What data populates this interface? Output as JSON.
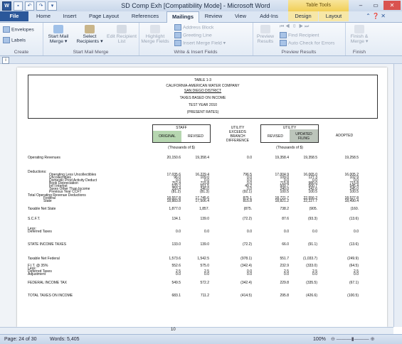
{
  "window": {
    "title": "SD Comp Exh [Compatibility Mode] - Microsoft Word",
    "contextual_label": "Table Tools",
    "qat_icons": [
      "word-icon",
      "save-icon",
      "undo-icon",
      "redo-icon",
      "customize-icon"
    ],
    "controls": {
      "minimize": "–",
      "restore": "▭",
      "close": "✕"
    }
  },
  "tabs": [
    "File",
    "Home",
    "Insert",
    "Page Layout",
    "References",
    "Mailings",
    "Review",
    "View",
    "Add-Ins",
    "Design",
    "Layout"
  ],
  "active_tab": "Mailings",
  "ribbon": {
    "create": {
      "label": "Create",
      "envelopes": "Envelopes",
      "labels": "Labels"
    },
    "start": {
      "label": "Start Mail Merge",
      "start_merge": "Start Mail Merge ▾",
      "select_recipients": "Select Recipients ▾",
      "edit_list": "Edit Recipient List"
    },
    "write": {
      "label": "Write & Insert Fields",
      "highlight": "Highlight Merge Fields",
      "address_block": "Address Block",
      "greeting_line": "Greeting Line",
      "insert_field": "Insert Merge Field ▾"
    },
    "preview": {
      "label": "Preview Results",
      "preview_results": "Preview Results",
      "find_recipient": "Find Recipient",
      "auto_check": "Auto Check for Errors"
    },
    "finish": {
      "label": "Finish",
      "finish_merge": "Finish & Merge ▾"
    }
  },
  "document": {
    "table_no": "TABLE 1-3",
    "company": "CALIFORNIA-AMERICAN WATER COMPANY",
    "district": "SAN DIEGO DISTRICT",
    "subtitle": "TAXES BASED ON INCOME",
    "year": "TEST YEAR 2010",
    "rates": "(PRESENT RATES)",
    "staff_hdr": "STAFF",
    "original": "ORIGINAL",
    "revised": "REVISED",
    "utility_exceeds": "UTILITY EXCEEDS BRANCH DIFFERENCE",
    "utility_hdr": "UTILITY",
    "utility_revised": "REVISED",
    "updated_filing": "UPDATED FILING",
    "adopted": "ADOPTED",
    "thousands_staff": "(Thousands of $)",
    "thousands_util": "(Thousands of $)",
    "rows": [
      {
        "label": "Operating Revenues",
        "v": [
          "20,150.6",
          "19,358.4",
          "0.0",
          "19,358.4",
          "19,358.5",
          "19,258.5"
        ]
      },
      {
        "label": "Deductions:",
        "v": [
          "",
          "",
          "",
          "",
          "",
          ""
        ]
      },
      {
        "label": "Operating Less Uncollectibles",
        "v": [
          "17,035.6",
          "16,229.4",
          "796.5",
          "17,004.9",
          "16,065.0",
          "16,005.2"
        ]
      },
      {
        "label": "Uncollectibles",
        "v": [
          "96.0",
          "109.0",
          "0.0",
          "109.0",
          "127.3",
          "102.9"
        ]
      },
      {
        "label": "Domestic Prod Activity Deduct",
        "v": [
          "0.0",
          "0.0",
          "0.0",
          "0.0",
          "0.0",
          "0.0"
        ]
      },
      {
        "label": "Book Depreciation",
        "v": [
          "752.4",
          "715.8",
          "0.0",
          "715.8",
          "980.0",
          "715.8"
        ]
      },
      {
        "label": "Int'l Interest",
        "v": [
          "520.3",
          "551.5",
          "49.2",
          "500.7",
          "500.7",
          "545.4"
        ]
      },
      {
        "label": "Taxes Other Than Income",
        "v": [
          "250.4",
          "240.0",
          "0.0",
          "240.0",
          "242.6",
          "245.0"
        ]
      },
      {
        "label": "Previous Year CCFT",
        "v": [
          "(81.2)",
          "(81.3)",
          "(92.1)",
          "100.5",
          "100.5",
          "100.5"
        ]
      },
      {
        "label": "Total Operating Revenue Deductions",
        "v": [
          "",
          "",
          "",
          "",
          "",
          ""
        ]
      },
      {
        "label": "Federal",
        "v": [
          "18,557.8",
          "17,745.6",
          "875.1",
          "18,721.7",
          "22,556.2",
          "18,527.8"
        ]
      },
      {
        "label": "State",
        "v": [
          "18,883.8",
          "17,506.4",
          "815.8",
          "18,821.2",
          "22,227.7",
          "18,490.4"
        ]
      },
      {
        "label": "Taxable Net State",
        "v": [
          "1,877.0",
          "1,857.",
          "(875.",
          "738.2",
          "(905.",
          "(160."
        ]
      },
      {
        "label": "S.C.F.T.",
        "v": [
          "134.1",
          "139.0",
          "(72.2)",
          "87.6",
          "(93.3)",
          "(13.6)"
        ]
      },
      {
        "label": "Less:",
        "v": [
          "",
          "",
          "",
          "",
          "",
          ""
        ]
      },
      {
        "label": "Deferred Taxes",
        "v": [
          "0.0",
          "0.0",
          "0.0",
          "0.0",
          "0.0",
          "0.0"
        ]
      },
      {
        "label": "STATE INCOME TAXES",
        "v": [
          "133.0",
          "139.0",
          "(72.2)",
          "66.0",
          "(91.1)",
          "(13.6)"
        ]
      },
      {
        "label": "Taxable Net Federal",
        "v": [
          "1,573.6",
          "1,542.5",
          "(978.1)",
          "551.7",
          "(1,033.7)",
          "(249.9)"
        ]
      },
      {
        "label": "F.I.T. @ 35%",
        "v": [
          "552.6",
          "575.0",
          "(342.4)",
          "232.9",
          "(333.0)",
          "(64.5)"
        ]
      },
      {
        "label": "Less:",
        "v": [
          "",
          "",
          "",
          "",
          "",
          ""
        ]
      },
      {
        "label": "Deferred Taxes",
        "v": [
          "2.5",
          "2.5",
          "0.0",
          "2.5",
          "2.5",
          "2.5"
        ]
      },
      {
        "label": "Adjustment",
        "v": [
          "0.0",
          "0.0",
          "0.0",
          "0.0",
          "0.0",
          "0.0"
        ]
      },
      {
        "label": "FEDERAL INCOME TAX",
        "v": [
          "549.5",
          "572.2",
          "(342.4)",
          "229.8",
          "(335.5)",
          "(67.1)"
        ]
      },
      {
        "label": "TOTAL TAXES ON INCOME",
        "v": [
          "683.1",
          "711.2",
          "(414.5)",
          "295.8",
          "(426.6)",
          "(100.5)"
        ]
      }
    ]
  },
  "status": {
    "page": "Page: 24 of 30",
    "words": "Words: 5,405",
    "zoom": "100%",
    "hscroll_value": "10"
  }
}
